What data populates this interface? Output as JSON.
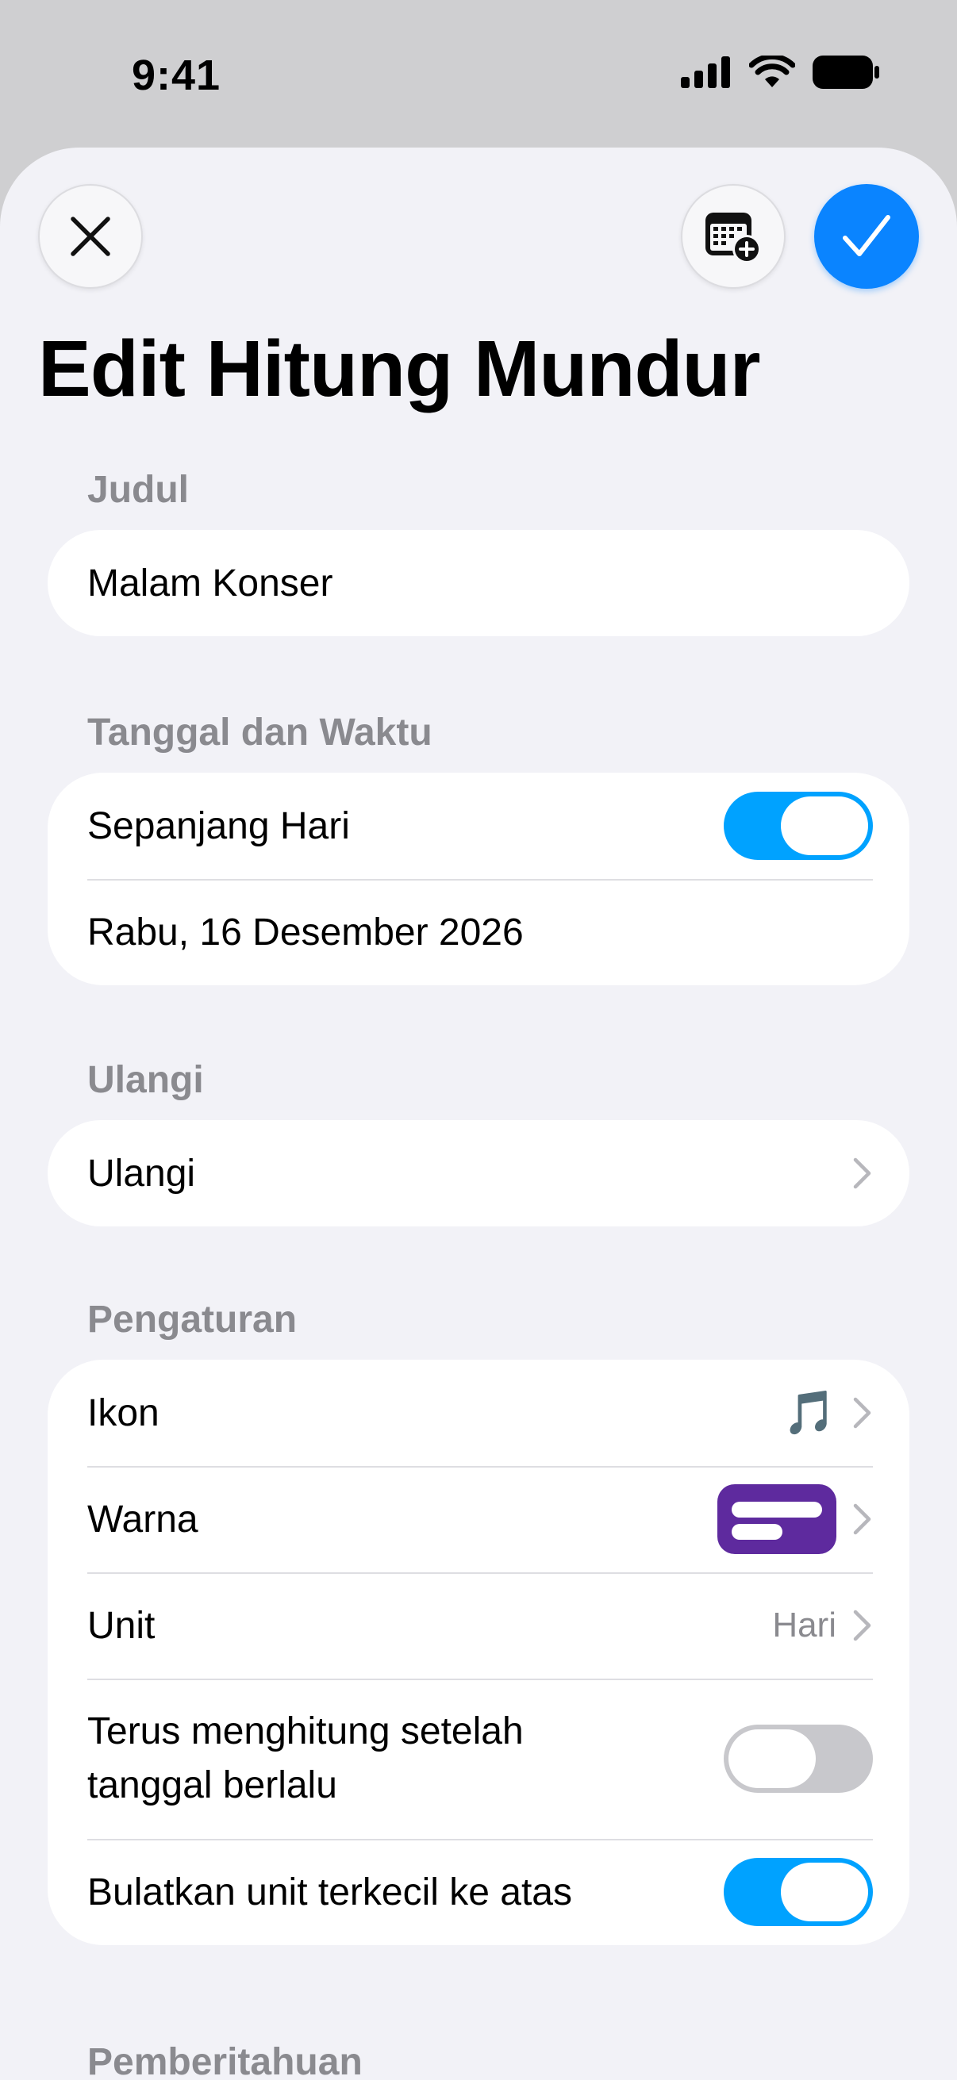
{
  "status_bar": {
    "time": "9:41"
  },
  "header": {
    "title": "Edit Hitung Mundur",
    "close_icon": "xmark-icon",
    "calendar_icon": "calendar-add-icon",
    "confirm_icon": "checkmark-icon",
    "accent_color": "#0a84ff"
  },
  "sections": {
    "title": {
      "label": "Judul",
      "value": "Malam Konser"
    },
    "datetime": {
      "label": "Tanggal dan Waktu",
      "all_day_label": "Sepanjang Hari",
      "all_day_on": true,
      "date": "Rabu, 16 Desember 2026"
    },
    "repeat": {
      "label": "Ulangi",
      "row_label": "Ulangi"
    },
    "settings": {
      "label": "Pengaturan",
      "icon_label": "Ikon",
      "icon_value": "🎵",
      "color_label": "Warna",
      "color_value": "#5e2a9e",
      "unit_label": "Unit",
      "unit_value": "Hari",
      "keep_counting_label_line1": "Terus menghitung setelah",
      "keep_counting_label_line2": "tanggal berlalu",
      "keep_counting_on": false,
      "round_up_label": "Bulatkan unit terkecil ke atas",
      "round_up_on": true
    },
    "notifications": {
      "label": "Pemberitahuan"
    }
  }
}
